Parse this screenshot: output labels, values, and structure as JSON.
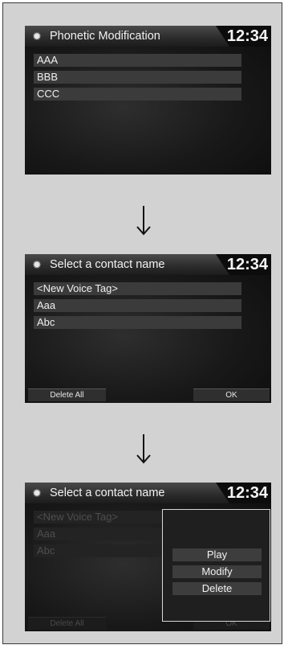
{
  "clock": "12:34",
  "screen1": {
    "title": "Phonetic Modification",
    "items": [
      "AAA",
      "BBB",
      "CCC"
    ]
  },
  "screen2": {
    "title": "Select a contact name",
    "items": [
      "<New Voice Tag>",
      "Aaa",
      "Abc"
    ],
    "delete_all_label": "Delete All",
    "ok_label": "OK"
  },
  "screen3": {
    "title": "Select a contact name",
    "items": [
      "<New Voice Tag>",
      "Aaa",
      "Abc"
    ],
    "delete_all_label": "Delete All",
    "ok_label": "OK",
    "popup_items": [
      "Play",
      "Modify",
      "Delete"
    ]
  },
  "icons": {
    "title_icon": "gear-icon",
    "step_arrow": "down-arrow-icon"
  },
  "colors": {
    "screen_bg": "#181818",
    "row_bg": "#3b3b3b",
    "text": "#f0f0f0",
    "popup_border": "#d8d8d8",
    "page_bg": "#d2d2d2"
  }
}
